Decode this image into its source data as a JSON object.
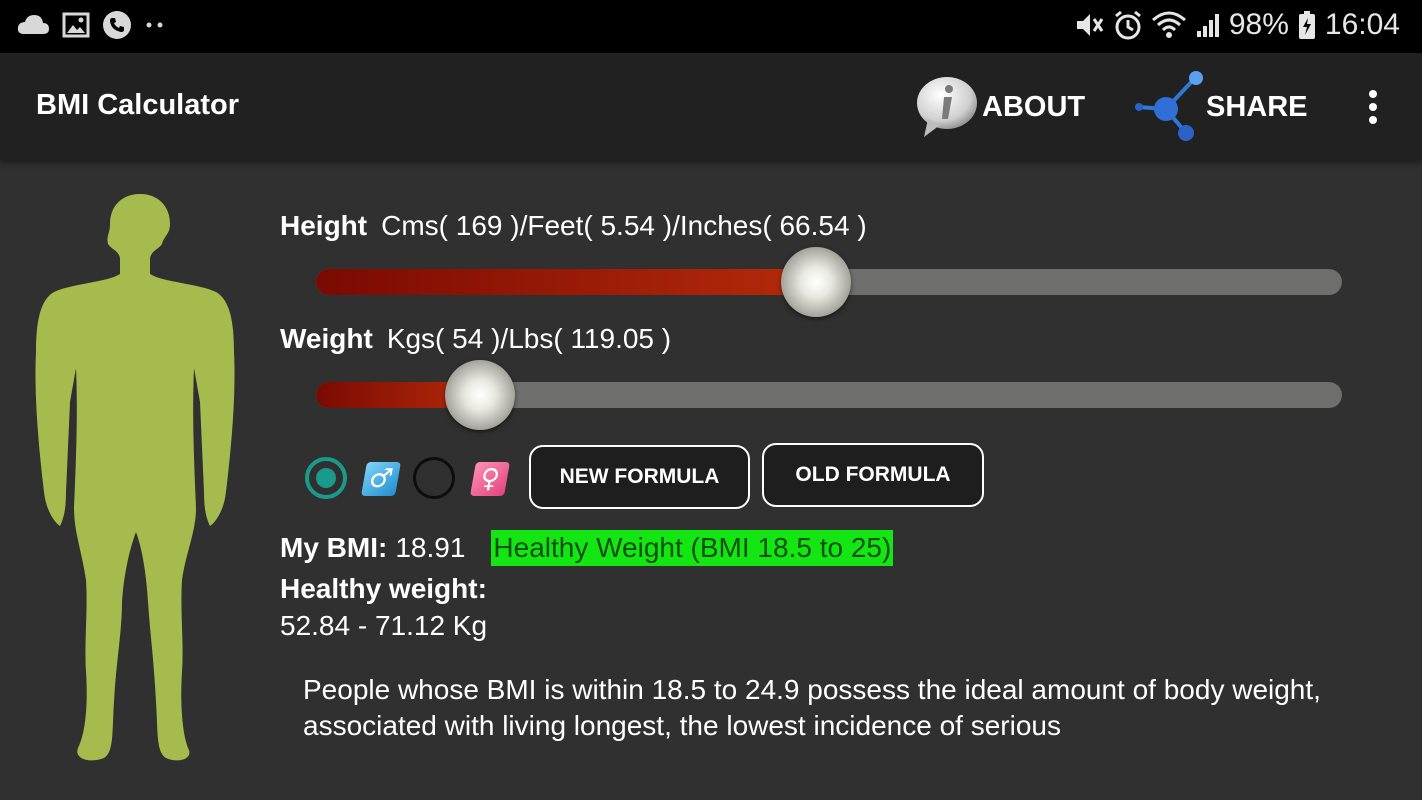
{
  "status_bar": {
    "left_icons": [
      "cloud-icon",
      "image-icon",
      "phone-call-icon",
      "more-notifications-icon"
    ],
    "right_icons": [
      "mute-icon",
      "alarm-icon",
      "wifi-icon",
      "signal-icon",
      "battery-charging-icon"
    ],
    "battery": "98%",
    "time": "16:04"
  },
  "app_bar": {
    "title": "BMI Calculator",
    "about_label": "ABOUT",
    "share_label": "SHARE"
  },
  "sliders": {
    "height": {
      "label": "Height",
      "value_text": "Cms( 169 )/Feet( 5.54 )/Inches( 66.54 )",
      "fraction": 0.487
    },
    "weight": {
      "label": "Weight",
      "value_text": "Kgs( 54 )/Lbs( 119.05 )",
      "fraction": 0.16
    }
  },
  "gender": {
    "male_selected": true,
    "male_symbol": "♂",
    "female_symbol": "♀"
  },
  "buttons": {
    "new_formula": "NEW FORMULA",
    "old_formula": "OLD FORMULA"
  },
  "result": {
    "bmi_label": "My BMI:",
    "bmi_value": "18.91",
    "category": "Healthy Weight (BMI 18.5 to 25)",
    "category_color": "#14e614",
    "healthy_weight_label": "Healthy weight:",
    "healthy_weight_range": "52.84 - 71.12 Kg"
  },
  "description": "People whose BMI is within 18.5 to 24.9 possess the ideal amount of body weight, associated with living longest, the lowest incidence of serious",
  "colors": {
    "accent_red": "#b52a0a",
    "figure_green": "#a6bb4e",
    "radio_teal": "#1a9a8a"
  }
}
